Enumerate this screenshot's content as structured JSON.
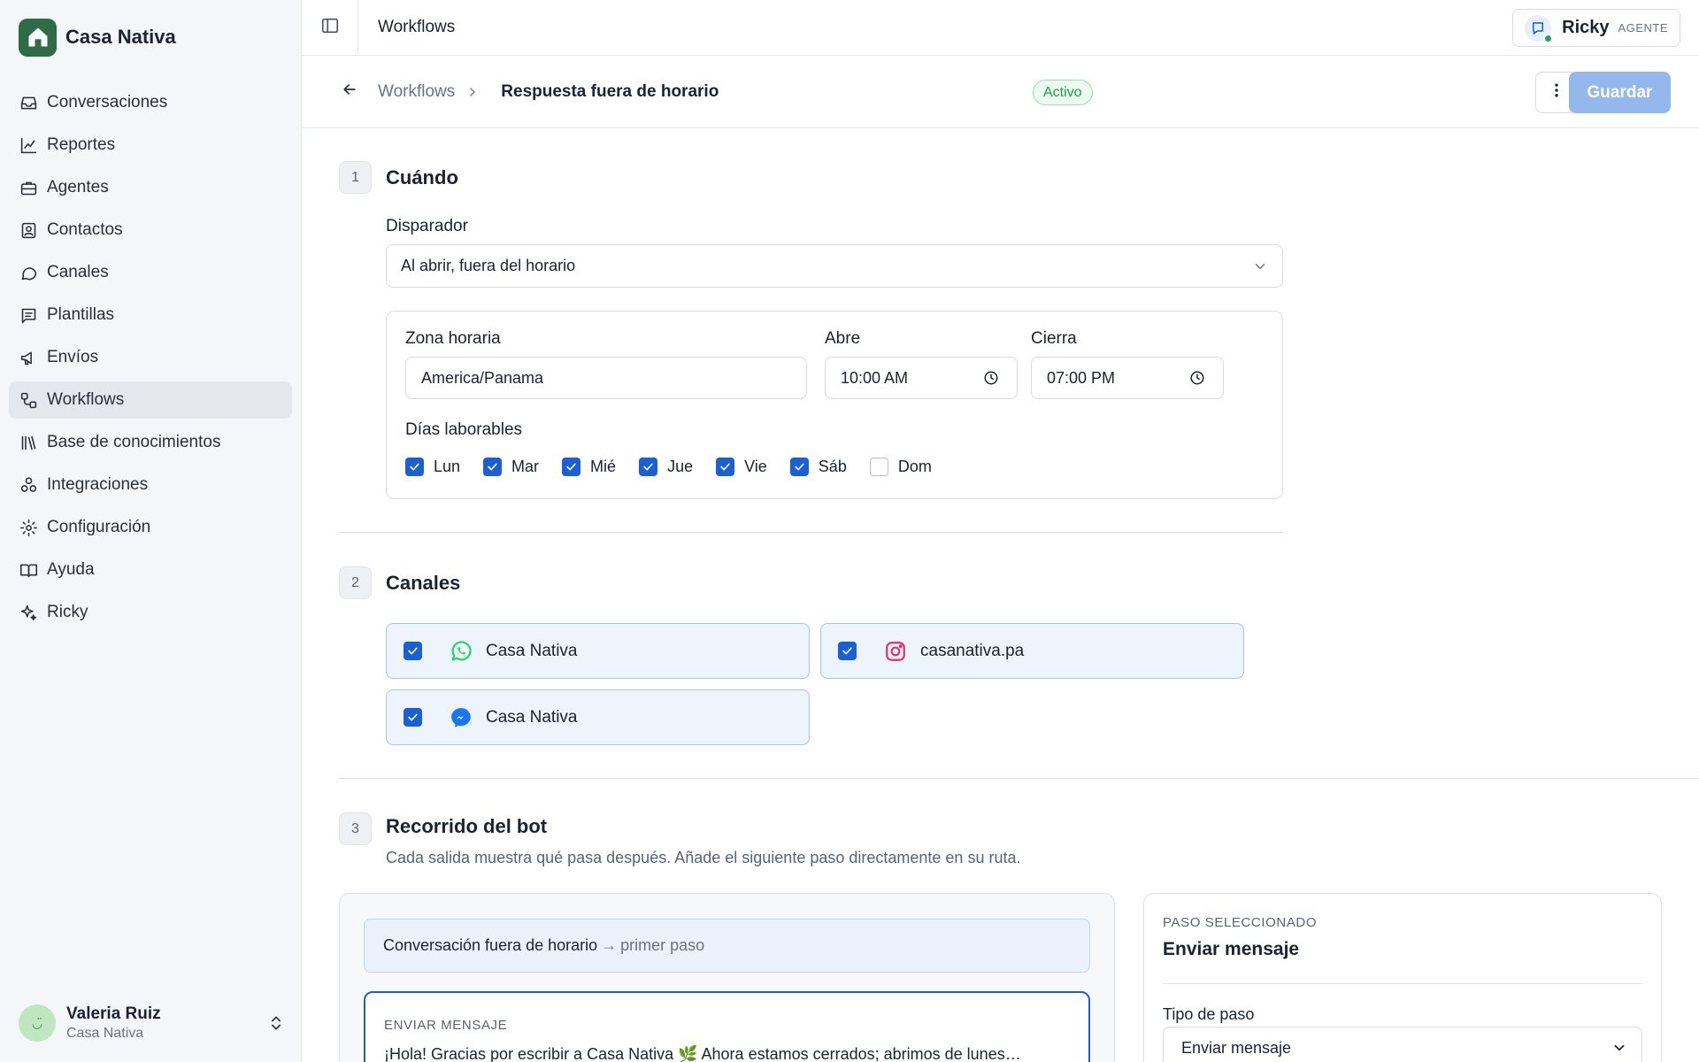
{
  "brand": {
    "name": "Casa Nativa"
  },
  "sidebar": {
    "items": [
      {
        "label": "Conversaciones",
        "icon": "inbox-icon"
      },
      {
        "label": "Reportes",
        "icon": "chart-line-icon"
      },
      {
        "label": "Agentes",
        "icon": "briefcase-icon"
      },
      {
        "label": "Contactos",
        "icon": "contact-card-icon"
      },
      {
        "label": "Canales",
        "icon": "chat-bubble-icon"
      },
      {
        "label": "Plantillas",
        "icon": "message-square-text-icon"
      },
      {
        "label": "Envíos",
        "icon": "megaphone-icon"
      },
      {
        "label": "Workflows",
        "icon": "workflow-icon",
        "active": true
      },
      {
        "label": "Base de conocimientos",
        "icon": "library-icon"
      },
      {
        "label": "Integraciones",
        "icon": "blocks-icon"
      },
      {
        "label": "Configuración",
        "icon": "gear-icon"
      },
      {
        "label": "Ayuda",
        "icon": "book-open-icon"
      },
      {
        "label": "Ricky",
        "icon": "sparkles-icon"
      }
    ]
  },
  "user": {
    "name": "Valeria Ruiz",
    "org": "Casa Nativa"
  },
  "topbar": {
    "title": "Workflows"
  },
  "agent": {
    "name": "Ricky",
    "role": "AGENTE",
    "online_color": "#22a35a"
  },
  "header": {
    "breadcrumb_parent": "Workflows",
    "breadcrumb_current": "Respuesta fuera de horario",
    "status": "Activo",
    "save_label": "Guardar"
  },
  "when": {
    "step": "1",
    "title": "Cuándo",
    "trigger_label": "Disparador",
    "trigger_value": "Al abrir, fuera del horario",
    "timezone_label": "Zona horaria",
    "timezone_value": "America/Panama",
    "opens_label": "Abre",
    "opens_value": "10:00 AM",
    "closes_label": "Cierra",
    "closes_value": "07:00 PM",
    "days_label": "Días laborables",
    "days": [
      {
        "label": "Lun",
        "checked": true
      },
      {
        "label": "Mar",
        "checked": true
      },
      {
        "label": "Mié",
        "checked": true
      },
      {
        "label": "Jue",
        "checked": true
      },
      {
        "label": "Vie",
        "checked": true
      },
      {
        "label": "Sáb",
        "checked": true
      },
      {
        "label": "Dom",
        "checked": false
      }
    ]
  },
  "channels": {
    "step": "2",
    "title": "Canales",
    "items": [
      {
        "name": "Casa Nativa",
        "icon": "whatsapp-icon",
        "checked": true,
        "color": "#25d366"
      },
      {
        "name": "casanativa.pa",
        "icon": "instagram-icon",
        "checked": true,
        "color": "#e1306c"
      },
      {
        "name": "Casa Nativa",
        "icon": "messenger-icon",
        "checked": true,
        "color": "#1877f2"
      }
    ]
  },
  "journey": {
    "step": "3",
    "title": "Recorrido del bot",
    "description": "Cada salida muestra qué pasa después. Añade el siguiente paso directamente en su ruta.",
    "entry_source": "Conversación fuera de horario",
    "entry_target": "primer paso",
    "node_type": "ENVIAR MENSAJE",
    "node_text": "¡Hola! Gracias por escribir a Casa Nativa 🌿 Ahora estamos cerrados; abrimos de lunes…"
  },
  "selected_step": {
    "kicker": "PASO SELECCIONADO",
    "title": "Enviar mensaje",
    "type_label": "Tipo de paso",
    "type_value": "Enviar mensaje"
  },
  "colors": {
    "accent": "#1a5fd4",
    "brand": "#2f6b45",
    "success": "#1f9a55"
  }
}
